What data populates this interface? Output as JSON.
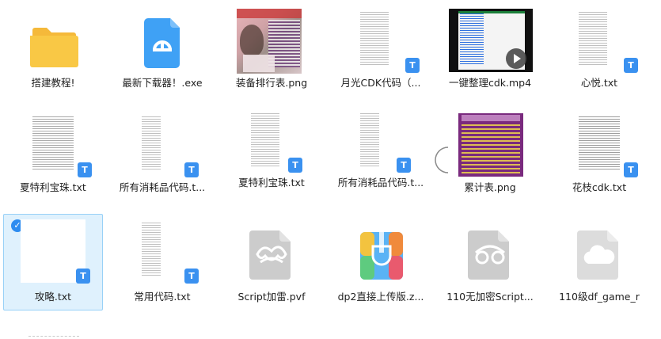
{
  "files": [
    {
      "name": "搭建教程!",
      "type": "folder"
    },
    {
      "name": "最新下载器！.exe",
      "type": "exe"
    },
    {
      "name": "装备排行表.png",
      "type": "png"
    },
    {
      "name": "月光CDK代码（...",
      "type": "txt"
    },
    {
      "name": "一键整理cdk.mp4",
      "type": "mp4"
    },
    {
      "name": "心悦.txt",
      "type": "txt"
    },
    {
      "name": "夏特利宝珠.txt",
      "type": "txt"
    },
    {
      "name": "所有消耗品代码.t...",
      "type": "txt"
    },
    {
      "name": "夏特利宝珠.txt",
      "type": "txt"
    },
    {
      "name": "所有消耗品代码.t...",
      "type": "txt"
    },
    {
      "name": "累计表.png",
      "type": "png"
    },
    {
      "name": "花枝cdk.txt",
      "type": "txt"
    },
    {
      "name": "攻略.txt",
      "type": "txt",
      "selected": true
    },
    {
      "name": "常用代码.txt",
      "type": "txt"
    },
    {
      "name": "Script加雷.pvf",
      "type": "pvf"
    },
    {
      "name": "dp2直接上传版.z...",
      "type": "zip"
    },
    {
      "name": "110无加密Script...",
      "type": "pvf"
    },
    {
      "name": "110级df_game_r",
      "type": "file"
    }
  ],
  "icons": {
    "txt_badge": "T",
    "check": "✓"
  },
  "colors": {
    "folder": "#f9c845",
    "exe": "#3fa1f5",
    "txt_badge": "#3a91f0",
    "selection": "#dff1fd",
    "selection_border": "#98d1f7"
  }
}
